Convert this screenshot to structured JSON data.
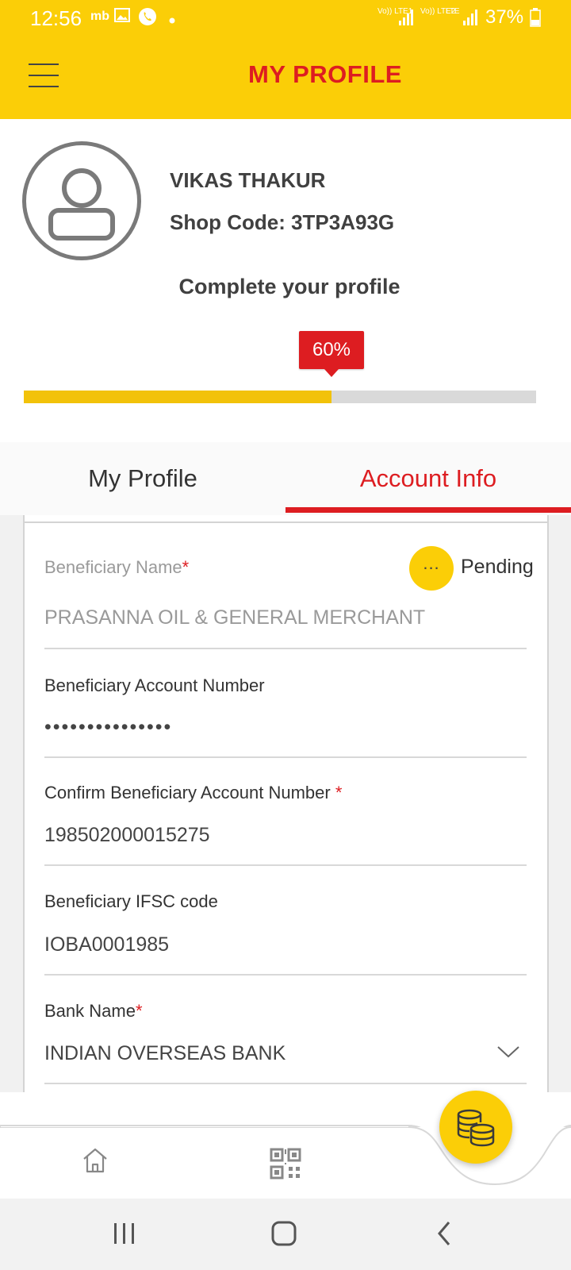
{
  "status_bar": {
    "time": "12:56",
    "carrier_label": "mb",
    "sim1_label": "Vo)) LTE1",
    "sim2_label": "Vo)) LTE2",
    "lte_label": "LTE",
    "battery": "37%"
  },
  "header": {
    "title": "MY PROFILE"
  },
  "profile": {
    "name": "VIKAS THAKUR",
    "shop_code": "Shop Code: 3TP3A93G",
    "complete_title": "Complete your profile",
    "completion_label": "60%",
    "completion_fraction": 0.6
  },
  "tabs": [
    {
      "label": "My Profile",
      "active": false
    },
    {
      "label": "Account Info",
      "active": true
    }
  ],
  "form": {
    "beneficiary_name": {
      "label": "Beneficiary Name",
      "required_mark": "*",
      "value": "PRASANNA OIL & GENERAL MERCHANT",
      "status_icon": "...",
      "status": "Pending"
    },
    "account_number": {
      "label": "Beneficiary Account Number",
      "value": "•••••••••••••••"
    },
    "confirm_account_number": {
      "label": "Confirm Beneficiary Account Number ",
      "required_mark": "*",
      "value": "198502000015275"
    },
    "ifsc": {
      "label": "Beneficiary IFSC code",
      "value": "IOBA0001985"
    },
    "bank_name": {
      "label": "Bank Name",
      "required_mark": "*",
      "value": "INDIAN OVERSEAS BANK"
    }
  },
  "bottom_nav": {
    "items": [
      {
        "icon": "home-icon"
      },
      {
        "icon": "qr-code-icon"
      },
      {
        "icon": "coins-icon"
      }
    ]
  },
  "colors": {
    "brand_yellow": "#FBCE07",
    "brand_red": "#DD1D21"
  }
}
